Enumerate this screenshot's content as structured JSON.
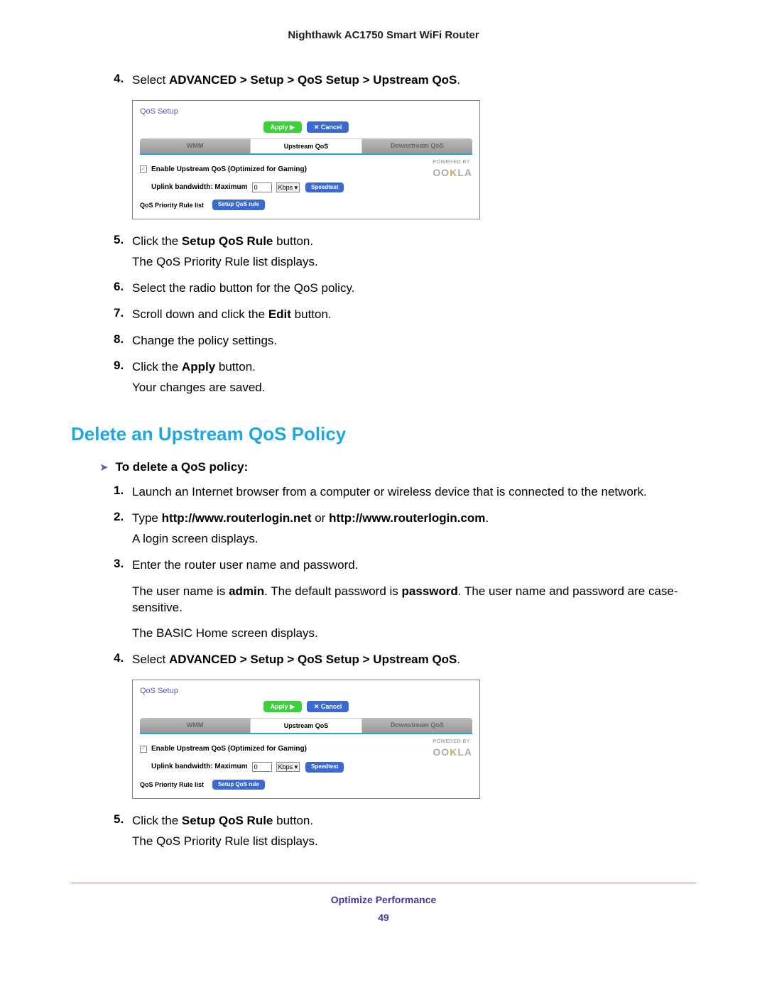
{
  "header": "Nighthawk AC1750 Smart WiFi Router",
  "section1_steps": {
    "s4_num": "4.",
    "s4_a": "Select ",
    "s4_b": "ADVANCED > Setup > QoS Setup > Upstream QoS",
    "s4_c": ".",
    "s5_num": "5.",
    "s5_a": "Click the ",
    "s5_b": "Setup QoS Rule",
    "s5_c": " button.",
    "s5_p2": "The QoS Priority Rule list displays.",
    "s6_num": "6.",
    "s6": "Select the radio button for the QoS policy.",
    "s7_num": "7.",
    "s7_a": "Scroll down and click the ",
    "s7_b": "Edit",
    "s7_c": " button.",
    "s8_num": "8.",
    "s8": "Change the policy settings.",
    "s9_num": "9.",
    "s9_a": "Click the ",
    "s9_b": "Apply",
    "s9_c": " button.",
    "s9_p2": "Your changes are saved."
  },
  "heading": "Delete an Upstream QoS Policy",
  "intro_arrow": "➤",
  "intro": "To delete a QoS policy:",
  "section2_steps": {
    "s1_num": "1.",
    "s1": "Launch an Internet browser from a computer or wireless device that is connected to the network.",
    "s2_num": "2.",
    "s2_a": "Type ",
    "s2_b": "http://www.routerlogin.net",
    "s2_c": " or ",
    "s2_d": "http://www.routerlogin.com",
    "s2_e": ".",
    "s2_p2": "A login screen displays.",
    "s3_num": "3.",
    "s3": "Enter the router user name and password.",
    "s3_p2a": "The user name is ",
    "s3_p2b": "admin",
    "s3_p2c": ". The default password is ",
    "s3_p2d": "password",
    "s3_p2e": ". The user name and password are case-sensitive.",
    "s3_p3": "The BASIC Home screen displays.",
    "s4_num": "4.",
    "s4_a": "Select ",
    "s4_b": "ADVANCED > Setup > QoS Setup > Upstream QoS",
    "s4_c": ".",
    "s5_num": "5.",
    "s5_a": "Click the ",
    "s5_b": "Setup QoS Rule",
    "s5_c": " button.",
    "s5_p2": "The QoS Priority Rule list displays."
  },
  "shot": {
    "title": "QoS Setup",
    "apply": "Apply ▶",
    "cancel": "✕ Cancel",
    "tab_wmm": "WMM",
    "tab_up": "Upstream QoS",
    "tab_down": "Downstream QoS",
    "enable": "Enable Upstream QoS (Optimized for Gaming)",
    "uplink": "Uplink bandwidth: Maximum",
    "uplink_val": "0",
    "kbps": "Kbps",
    "speedtest": "Speedtest",
    "powered": "POWERED BY",
    "ookla_a": "OO",
    "ookla_b": "K",
    "ookla_c": "LA",
    "priority": "QoS Priority Rule list",
    "setup_rule": "Setup QoS rule",
    "check": "✓",
    "sel_arrow": "▾"
  },
  "footer": {
    "title": "Optimize Performance",
    "page": "49"
  }
}
